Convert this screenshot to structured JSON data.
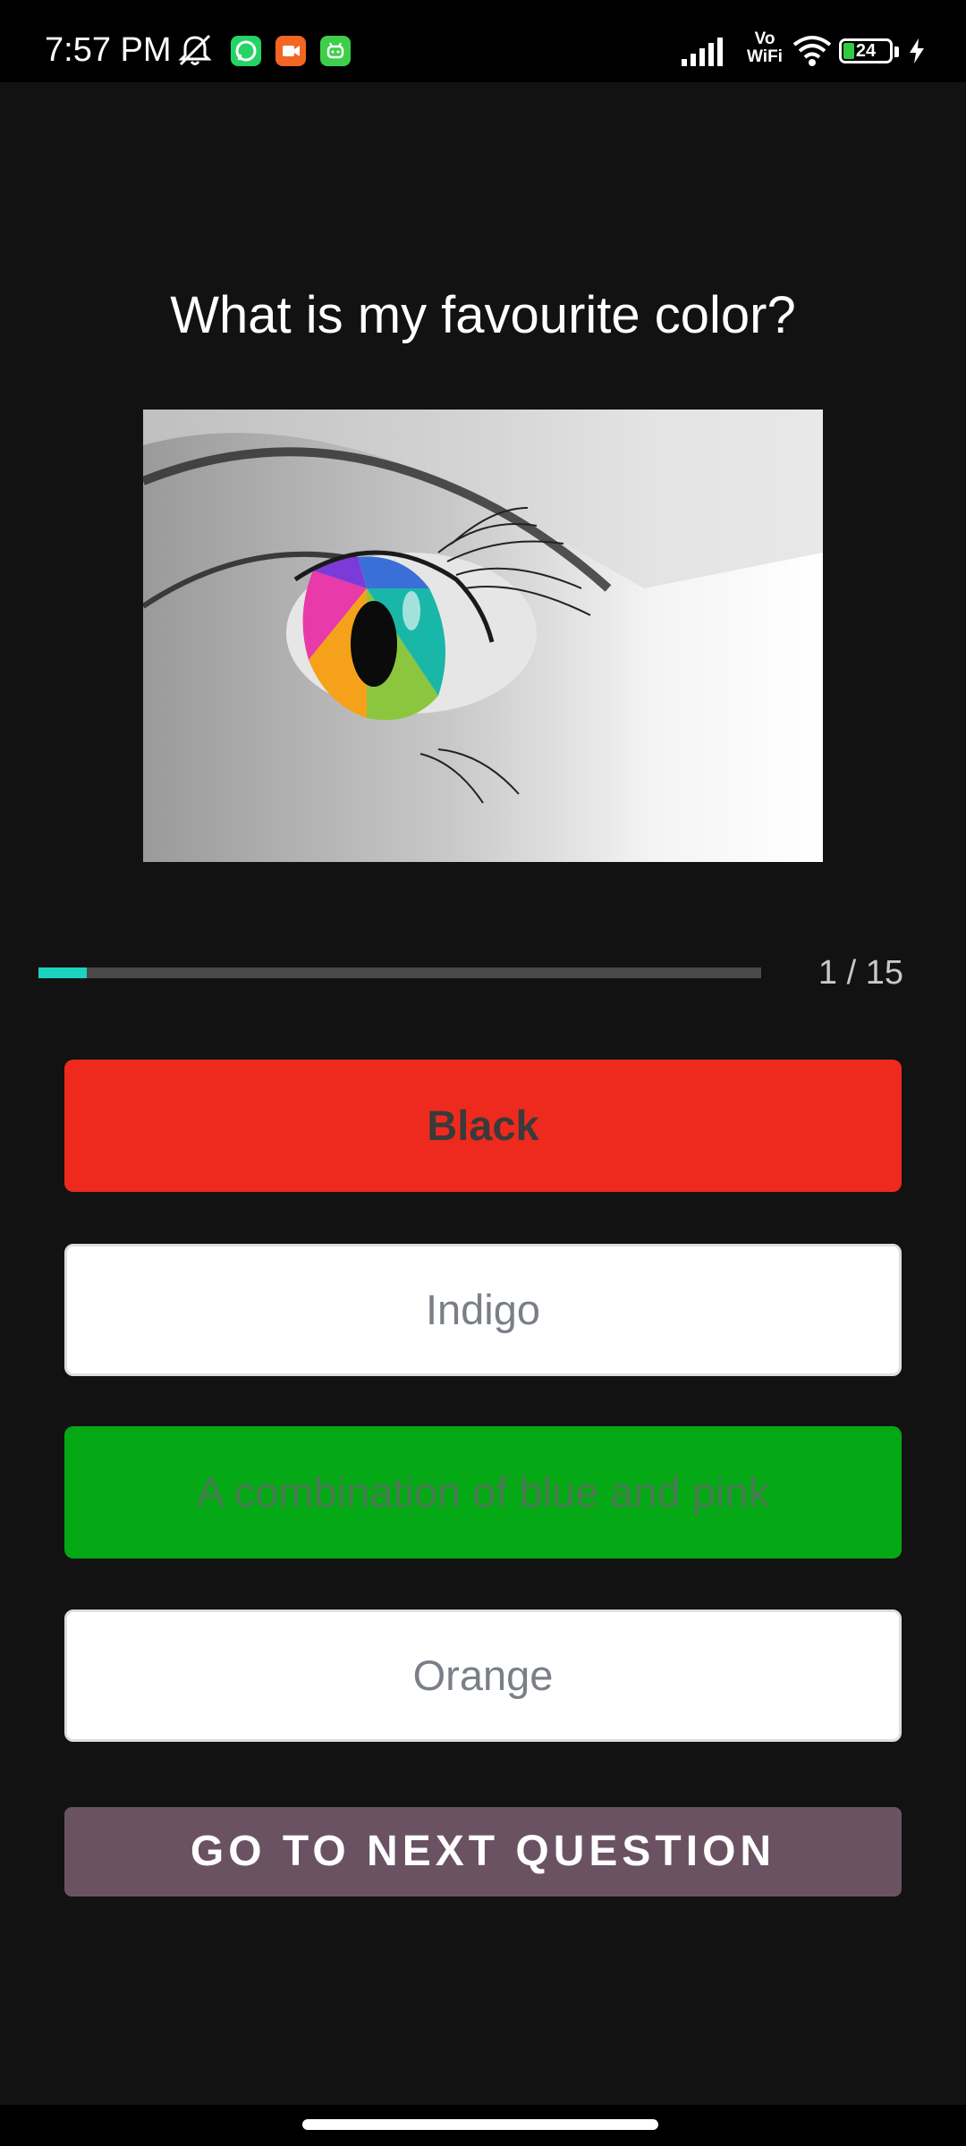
{
  "status_bar": {
    "time": "7:57 PM",
    "network_label": "Vo\nWiFi",
    "battery_level": "24",
    "icons": [
      "mute-icon",
      "whatsapp-icon",
      "video-app-icon",
      "android-app-icon",
      "signal-icon",
      "wifi-icon",
      "battery-icon",
      "charging-icon"
    ],
    "colors": {
      "whatsapp": "#25d366",
      "video_app": "#f26522",
      "android_app": "#3ecf4a"
    }
  },
  "question": {
    "title": "What is my favourite color?",
    "image_alt": "rainbow-eye"
  },
  "progress": {
    "current": 1,
    "total": 15,
    "label": "1 / 15",
    "fraction": 0.0667,
    "color": "#1ed2c0"
  },
  "options": [
    {
      "label": "Black",
      "state": "selected-wrong",
      "color": "#ee2a1e"
    },
    {
      "label": "Indigo",
      "state": "neutral",
      "color": "#ffffff"
    },
    {
      "label": "A combination of blue and pink",
      "state": "correct",
      "color": "#04a814"
    },
    {
      "label": "Orange",
      "state": "neutral",
      "color": "#ffffff"
    }
  ],
  "next_button": {
    "label": "GO TO NEXT QUESTION",
    "color": "#6a5263"
  }
}
